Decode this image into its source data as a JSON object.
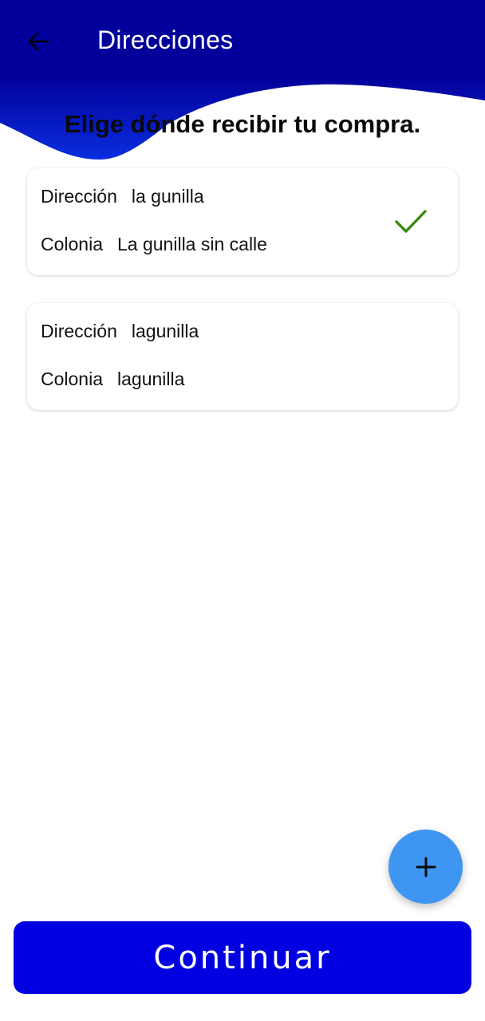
{
  "header": {
    "title": "Direcciones",
    "back_icon": "arrow-left-icon",
    "color": "#02009a"
  },
  "prompt": "Elige dónde recibir tu compra.",
  "addresses": [
    {
      "direccion_label": "Dirección",
      "direccion_value": "la gunilla",
      "colonia_label": "Colonia",
      "colonia_value": "La gunilla sin calle",
      "selected": true,
      "selected_icon": "check-icon"
    },
    {
      "direccion_label": "Dirección",
      "direccion_value": "lagunilla",
      "colonia_label": "Colonia",
      "colonia_value": "lagunilla",
      "selected": false
    }
  ],
  "fab": {
    "icon": "plus-icon",
    "color": "#3f95f2"
  },
  "continue_button": {
    "label": "Continuar",
    "color": "#0000e0"
  },
  "colors": {
    "check": "#3a8a10"
  }
}
